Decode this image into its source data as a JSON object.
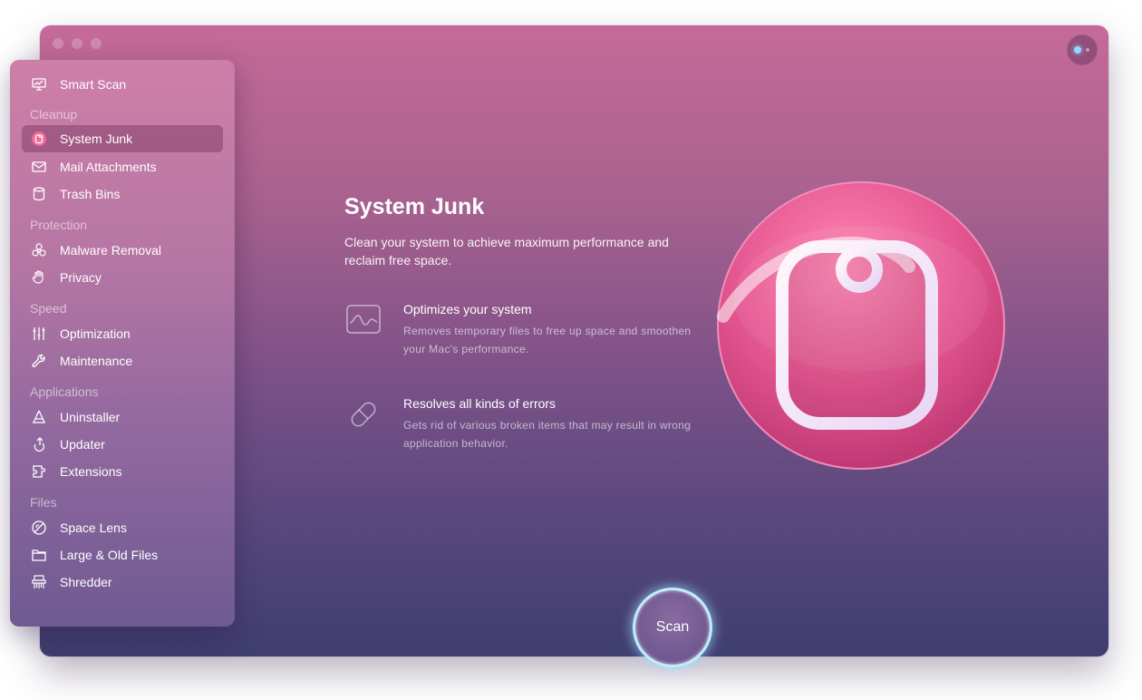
{
  "window": {
    "traffic_lights": [
      "close",
      "minimize",
      "zoom"
    ],
    "assistant_icon": "assistant-icon"
  },
  "sidebar": {
    "top_item": {
      "label": "Smart Scan",
      "icon": "monitor-icon"
    },
    "sections": [
      {
        "title": "Cleanup",
        "items": [
          {
            "label": "System Junk",
            "icon": "system-junk-icon",
            "active": true
          },
          {
            "label": "Mail Attachments",
            "icon": "envelope-icon"
          },
          {
            "label": "Trash Bins",
            "icon": "trash-icon"
          }
        ]
      },
      {
        "title": "Protection",
        "items": [
          {
            "label": "Malware Removal",
            "icon": "biohazard-icon"
          },
          {
            "label": "Privacy",
            "icon": "hand-icon"
          }
        ]
      },
      {
        "title": "Speed",
        "items": [
          {
            "label": "Optimization",
            "icon": "sliders-icon"
          },
          {
            "label": "Maintenance",
            "icon": "wrench-icon"
          }
        ]
      },
      {
        "title": "Applications",
        "items": [
          {
            "label": "Uninstaller",
            "icon": "uninstaller-icon"
          },
          {
            "label": "Updater",
            "icon": "update-arrow-icon"
          },
          {
            "label": "Extensions",
            "icon": "extensions-icon"
          }
        ]
      },
      {
        "title": "Files",
        "items": [
          {
            "label": "Space Lens",
            "icon": "space-lens-icon"
          },
          {
            "label": "Large & Old Files",
            "icon": "folder-icon"
          },
          {
            "label": "Shredder",
            "icon": "shredder-icon"
          }
        ]
      }
    ]
  },
  "main": {
    "title": "System Junk",
    "description": "Clean your system to achieve maximum performance and reclaim free space.",
    "features": [
      {
        "title": "Optimizes your system",
        "description": "Removes temporary files to free up space and smoothen your Mac's performance.",
        "icon": "monitor-wave-icon"
      },
      {
        "title": "Resolves all kinds of errors",
        "description": "Gets rid of various broken items that may result in wrong application behavior.",
        "icon": "pill-icon"
      }
    ],
    "hero_icon": "system-junk-hero-icon",
    "scan_label": "Scan"
  },
  "colors": {
    "accent_scan_ring": "#bfeeff",
    "hero_pink": "#e9548e"
  }
}
